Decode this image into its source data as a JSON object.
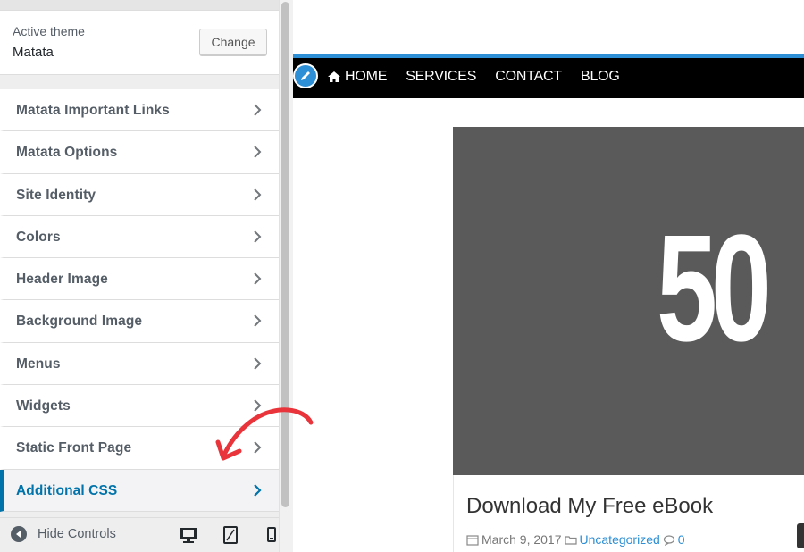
{
  "sidebar": {
    "active_theme_label": "Active theme",
    "active_theme_name": "Matata",
    "change_button": "Change",
    "items": [
      {
        "label": "Matata Important Links",
        "active": false
      },
      {
        "label": "Matata Options",
        "active": false
      },
      {
        "label": "Site Identity",
        "active": false
      },
      {
        "label": "Colors",
        "active": false
      },
      {
        "label": "Header Image",
        "active": false
      },
      {
        "label": "Background Image",
        "active": false
      },
      {
        "label": "Menus",
        "active": false
      },
      {
        "label": "Widgets",
        "active": false
      },
      {
        "label": "Static Front Page",
        "active": false
      },
      {
        "label": "Additional CSS",
        "active": true
      }
    ],
    "footer": {
      "hide_controls_label": "Hide Controls",
      "devices": [
        "desktop-icon",
        "tablet-icon",
        "mobile-icon"
      ]
    }
  },
  "preview": {
    "nav": [
      {
        "label": "HOME",
        "icon": "home-icon"
      },
      {
        "label": "SERVICES"
      },
      {
        "label": "CONTACT"
      },
      {
        "label": "BLOG"
      }
    ],
    "post": {
      "image_text": "50",
      "title": "Download My Free eBook",
      "date": "March 9, 2017",
      "category": "Uncategorized",
      "comments": "0"
    }
  },
  "colors": {
    "accent": "#0073aa",
    "nav_bar": "#000000",
    "nav_accent": "#2d8fd5",
    "annotation_arrow": "#e8343a",
    "post_image_bg": "#5a5a5a"
  }
}
